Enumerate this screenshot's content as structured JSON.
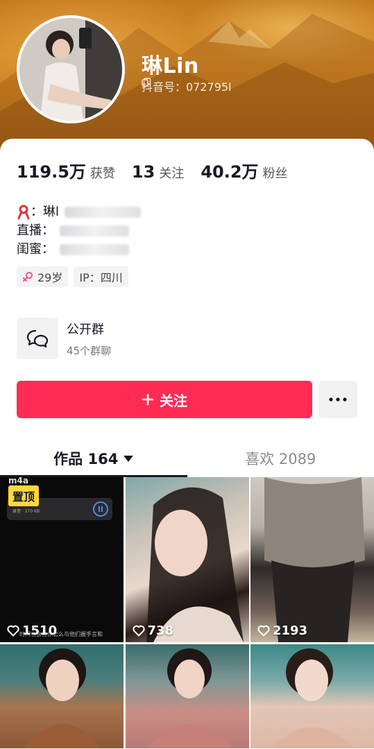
{
  "profile": {
    "nickname": "琳Lin",
    "douyin_id": "抖音号：072795l"
  },
  "stats": [
    {
      "value": "119.5万",
      "label": "获赞"
    },
    {
      "value": "13",
      "label": "关注"
    },
    {
      "value": "40.2万",
      "label": "粉丝"
    }
  ],
  "bio": {
    "line1_label": "：琳l",
    "line2_label": "直播：",
    "line3_label": "闺蜜："
  },
  "tags": {
    "age": "29岁",
    "ip": "IP：四川"
  },
  "group": {
    "title": "公开群",
    "subtitle": "45个群聊"
  },
  "actions": {
    "follow_label": "关注",
    "more_label": "•••"
  },
  "tabs": {
    "works": "作品 164",
    "likes": "喜欢 2089"
  },
  "videos": [
    {
      "likes": "1510",
      "pinned_label": "置顶",
      "audio_label": "m4a",
      "player_meta": "录音 · 270 KB",
      "caption": "时间也会教你怎么与他们握手言和"
    },
    {
      "likes": "738"
    },
    {
      "likes": "2193"
    },
    {
      "likes": ""
    },
    {
      "likes": ""
    },
    {
      "likes": ""
    }
  ],
  "colors": {
    "accent": "#fe2c55",
    "pin": "#ffd83b",
    "banner": "#c9801f"
  }
}
